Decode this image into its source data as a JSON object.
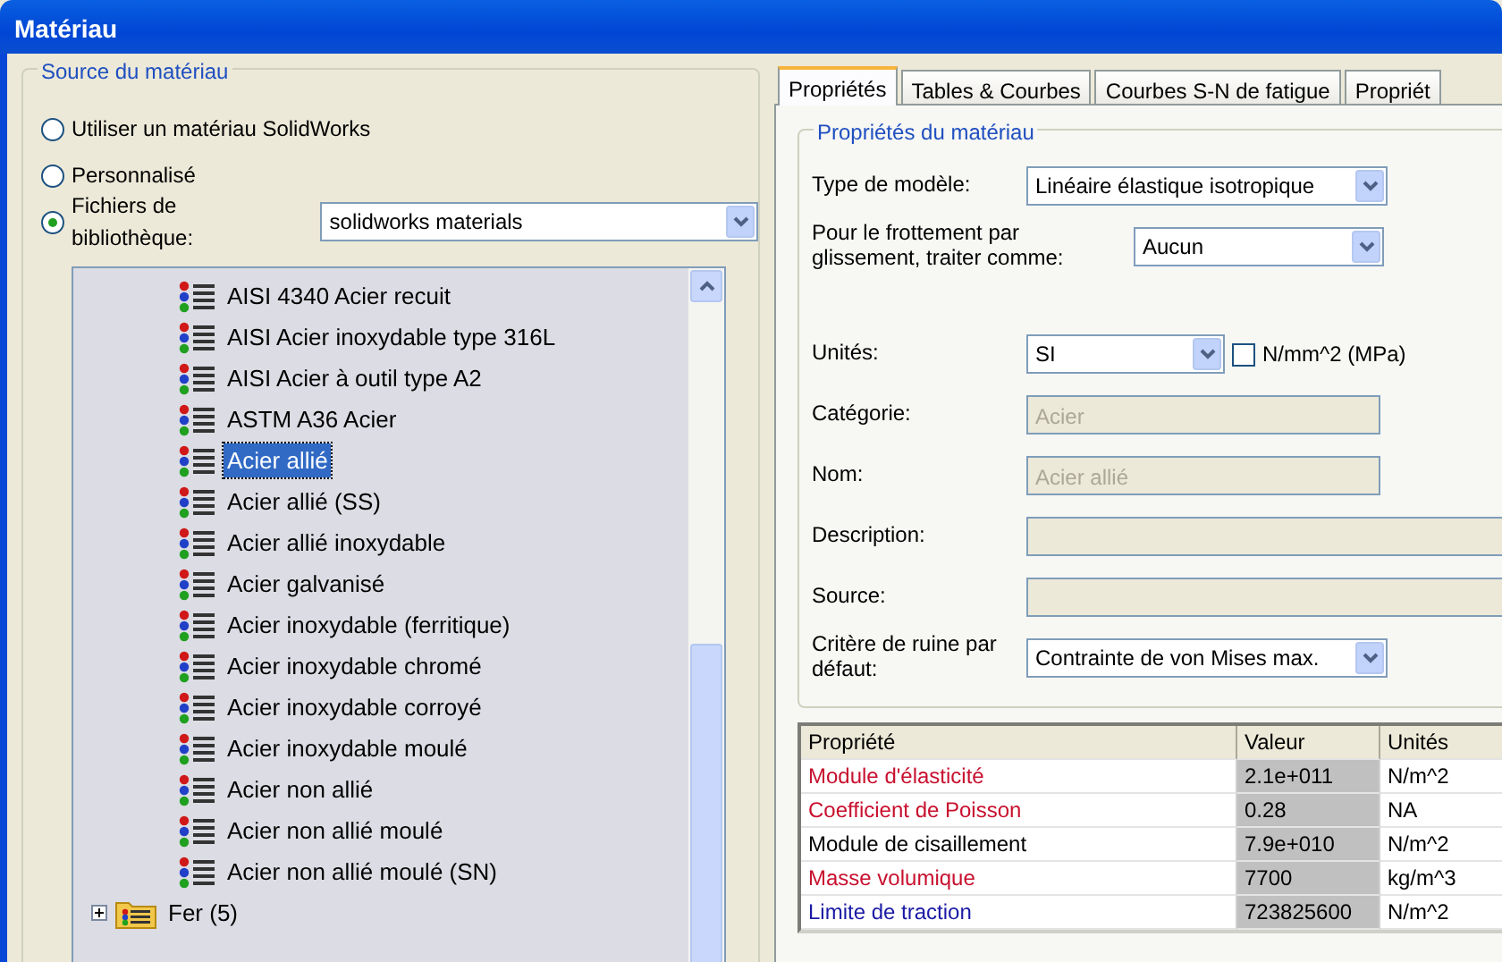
{
  "window": {
    "title": "Matériau"
  },
  "source": {
    "title": "Source du matériau",
    "options": [
      {
        "label": "Utiliser un matériau SolidWorks",
        "selected": false
      },
      {
        "label": "Personnalisé",
        "selected": false
      },
      {
        "label": "Fichiers de bibliothèque:",
        "selected": true
      }
    ],
    "library": "solidworks materials",
    "tree": [
      {
        "label": "AISI 4340 Acier recuit",
        "kind": "material",
        "selected": false
      },
      {
        "label": "AISI Acier inoxydable type 316L",
        "kind": "material",
        "selected": false
      },
      {
        "label": "AISI Acier à outil type A2",
        "kind": "material",
        "selected": false
      },
      {
        "label": "ASTM A36 Acier",
        "kind": "material",
        "selected": false
      },
      {
        "label": "Acier allié",
        "kind": "material",
        "selected": true
      },
      {
        "label": "Acier allié (SS)",
        "kind": "material",
        "selected": false
      },
      {
        "label": "Acier allié inoxydable",
        "kind": "material",
        "selected": false
      },
      {
        "label": "Acier galvanisé",
        "kind": "material",
        "selected": false
      },
      {
        "label": "Acier inoxydable (ferritique)",
        "kind": "material",
        "selected": false
      },
      {
        "label": "Acier inoxydable chromé",
        "kind": "material",
        "selected": false
      },
      {
        "label": "Acier inoxydable corroyé",
        "kind": "material",
        "selected": false
      },
      {
        "label": "Acier inoxydable moulé",
        "kind": "material",
        "selected": false
      },
      {
        "label": "Acier non allié",
        "kind": "material",
        "selected": false
      },
      {
        "label": "Acier non allié moulé",
        "kind": "material",
        "selected": false
      },
      {
        "label": "Acier non allié moulé (SN)",
        "kind": "material",
        "selected": false
      },
      {
        "label": "Fer (5)",
        "kind": "folder",
        "selected": false,
        "expanded": false
      }
    ]
  },
  "tabs": [
    {
      "label": "Propriétés",
      "selected": true
    },
    {
      "label": "Tables & Courbes",
      "selected": false
    },
    {
      "label": "Courbes S-N de fatigue",
      "selected": false
    },
    {
      "label": "Propriét",
      "selected": false
    }
  ],
  "properties": {
    "title": "Propriétés du matériau",
    "fields": [
      {
        "kind": "select",
        "label": "Type de modèle:",
        "value": "Linéaire élastique isotropique"
      },
      {
        "kind": "select",
        "label": "Pour le frottement par glissement, traiter comme:",
        "value": "Aucun"
      },
      {
        "kind": "units",
        "label": "Unités:",
        "value": "SI",
        "checkbox": {
          "label": "N/mm^2 (MPa)",
          "checked": false
        }
      },
      {
        "kind": "text",
        "label": "Catégorie:",
        "value": "Acier",
        "disabled": true
      },
      {
        "kind": "text",
        "label": "Nom:",
        "value": "Acier allié",
        "disabled": true
      },
      {
        "kind": "wide",
        "label": "Description:",
        "disabled": true
      },
      {
        "kind": "wide",
        "label": "Source:",
        "disabled": true
      },
      {
        "kind": "select",
        "label": "Critère de ruine par défaut:",
        "value": "Contrainte de von Mises max."
      }
    ]
  },
  "table": {
    "columns": [
      "Propriété",
      "Valeur",
      "Unités"
    ],
    "rows": [
      {
        "cells": [
          "Module d'élasticité",
          "2.1e+011",
          "N/m^2"
        ],
        "color": "#c8102e"
      },
      {
        "cells": [
          "Coefficient de Poisson",
          "0.28",
          "NA"
        ],
        "color": "#c8102e"
      },
      {
        "cells": [
          "Module de cisaillement",
          "7.9e+010",
          "N/m^2"
        ],
        "color": "#000000"
      },
      {
        "cells": [
          "Masse volumique",
          "7700",
          "kg/m^3"
        ],
        "color": "#c8102e"
      },
      {
        "cells": [
          "Limite de traction",
          "723825600",
          "N/m^2"
        ],
        "color": "#1a1aa6"
      }
    ]
  }
}
